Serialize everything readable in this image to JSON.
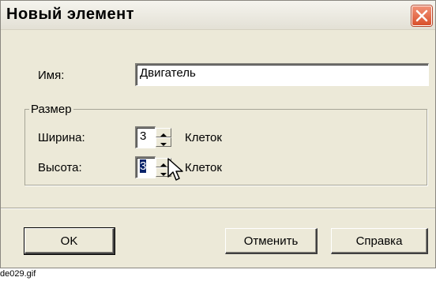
{
  "dialog": {
    "title": "Новый элемент",
    "name_label": "Имя:",
    "name_value": "Двигатель",
    "size_group": "Размер",
    "width_label": "Ширина:",
    "width_value": "3",
    "width_unit": "Клеток",
    "height_label": "Высота:",
    "height_value": "3",
    "height_unit": "Клеток"
  },
  "buttons": {
    "ok": "OK",
    "cancel": "Отменить",
    "help": "Справка"
  },
  "caption": "de029.gif",
  "colors": {
    "dialog_bg": "#ece9d8",
    "close_button": "#d9502c",
    "selection": "#0a246a"
  }
}
